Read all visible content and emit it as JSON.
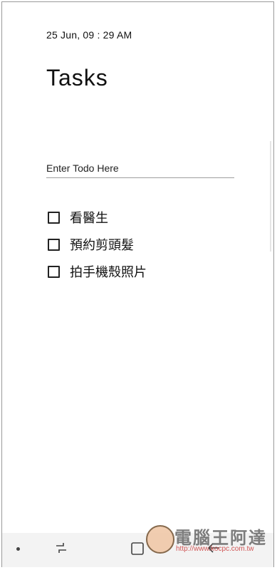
{
  "header": {
    "datetime": "25 Jun, 09 : 29 AM",
    "title": "Tasks"
  },
  "input": {
    "placeholder": "Enter Todo Here",
    "value": ""
  },
  "tasks": [
    {
      "label": "看醫生",
      "checked": false
    },
    {
      "label": "預約剪頭髮",
      "checked": false
    },
    {
      "label": "拍手機殼照片",
      "checked": false
    }
  ],
  "watermark": {
    "site_name": "電腦王阿達",
    "url": "http://www.kocpc.com.tw"
  },
  "colors": {
    "text": "#111111",
    "underline": "#9e9e9e",
    "navbar": "#f3f3f3"
  }
}
